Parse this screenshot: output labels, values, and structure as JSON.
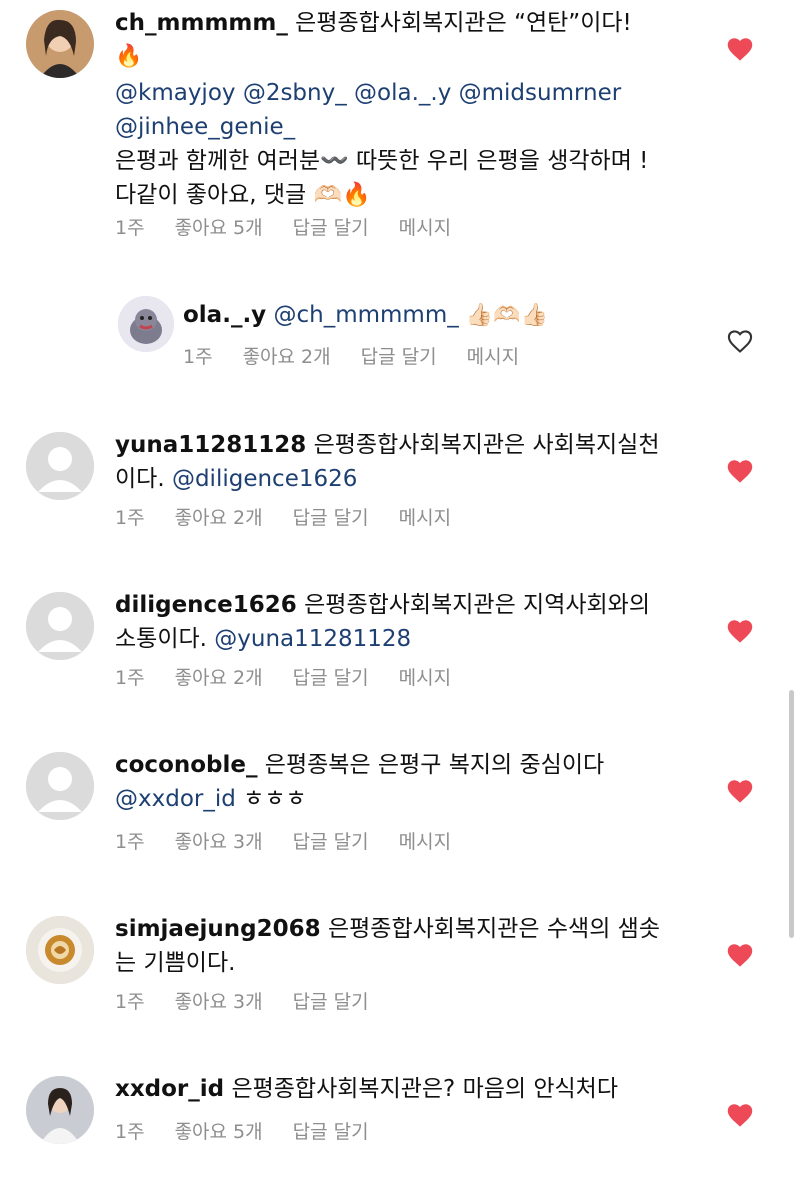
{
  "comments": [
    {
      "username": "ch_mmmmm_",
      "text1": " 은평종합사회복지관은 “연탄”이다!",
      "text2": "🔥",
      "mentions": "@kmayjoy @2sbny_  @ola._.y  @midsumrner",
      "mentions2": "@jinhee_genie_",
      "text3": "은평과 함께한 여러분〰️ 따뜻한 우리 은평을 생각하며 !",
      "text4": "다같이 좋아요, 댓글 🫶🏻🔥",
      "time": "1주",
      "likes": "좋아요 5개",
      "reply": "답글 달기",
      "message": "메시지",
      "liked": true
    },
    {
      "username": "ola._.y",
      "mention": " @ch_mmmmm_",
      "text": " 👍🏻🫶🏻👍🏻",
      "time": "1주",
      "likes": "좋아요 2개",
      "reply": "답글 달기",
      "message": "메시지",
      "liked": false
    },
    {
      "username": "yuna11281128",
      "text1": " 은평종합사회복지관은 사회복지실천",
      "text2": "이다. ",
      "mention": "@diligence1626",
      "time": "1주",
      "likes": "좋아요 2개",
      "reply": "답글 달기",
      "message": "메시지",
      "liked": true
    },
    {
      "username": "diligence1626",
      "text1": " 은평종합사회복지관은 지역사회와의",
      "text2": "소통이다. ",
      "mention": "@yuna11281128",
      "time": "1주",
      "likes": "좋아요 2개",
      "reply": "답글 달기",
      "message": "메시지",
      "liked": true
    },
    {
      "username": "coconoble_",
      "text1": " 은평종복은 은평구 복지의 중심이다",
      "mention": "@xxdor_id",
      "text2": " ㅎㅎㅎ",
      "time": "1주",
      "likes": "좋아요 3개",
      "reply": "답글 달기",
      "message": "메시지",
      "liked": true
    },
    {
      "username": "simjaejung2068",
      "text1": " 은평종합사회복지관은 수색의 샘솟",
      "text2": "는 기쁨이다.",
      "time": "1주",
      "likes": "좋아요 3개",
      "reply": "답글 달기",
      "liked": true
    },
    {
      "username": "xxdor_id",
      "text1": " 은평종합사회복지관은? 마음의 안식처다",
      "time": "1주",
      "likes": "좋아요 5개",
      "reply": "답글 달기",
      "liked": true
    }
  ],
  "colors": {
    "heart_filled": "#ed4956",
    "mention": "#1d3f72",
    "meta": "#8e8e8e"
  }
}
